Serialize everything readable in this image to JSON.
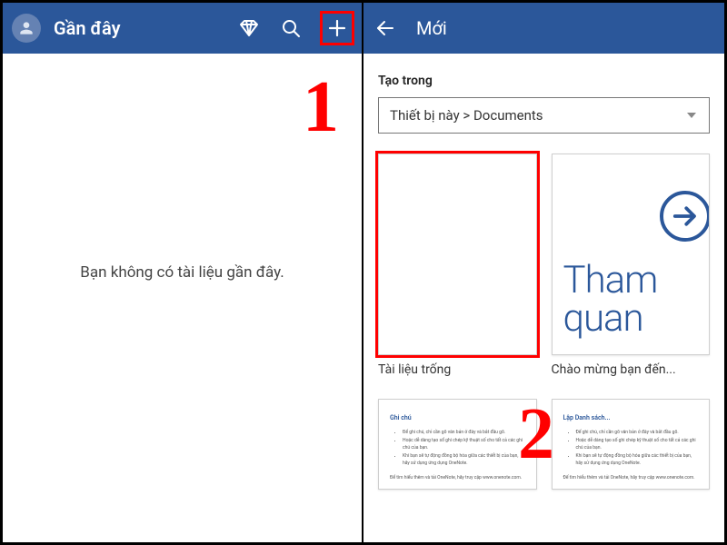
{
  "left": {
    "title": "Gần đây",
    "empty_message": "Bạn không có tài liệu gần đây.",
    "step_marker": "1"
  },
  "right": {
    "title": "Mới",
    "section_label": "Tạo trong",
    "location_dropdown": "Thiết bị này > Documents",
    "step_marker": "2",
    "templates": [
      {
        "label": "Tài liệu trống"
      },
      {
        "label": "Chào mừng bạn đến...",
        "preview_text": "Tham quan"
      }
    ],
    "row2_headers": [
      "Ghi chú",
      "Lập Danh sách..."
    ],
    "row2_lines": [
      "Để ghi chú, chỉ cần gõ văn bản ở đây và bắt đầu gõ.",
      "Hoặc dễ dàng tạo sổ ghi chép kỹ thuật số cho tất cả các ghi chú của bạn.",
      "Khi bạn sẽ tự động đồng bộ hóa giữa các thiết bị của bạn, hãy sử dụng ứng dụng OneNote."
    ],
    "row2_footer": "Để tìm hiểu thêm và tải OneNote, hãy truy cập www.onenote.com."
  }
}
